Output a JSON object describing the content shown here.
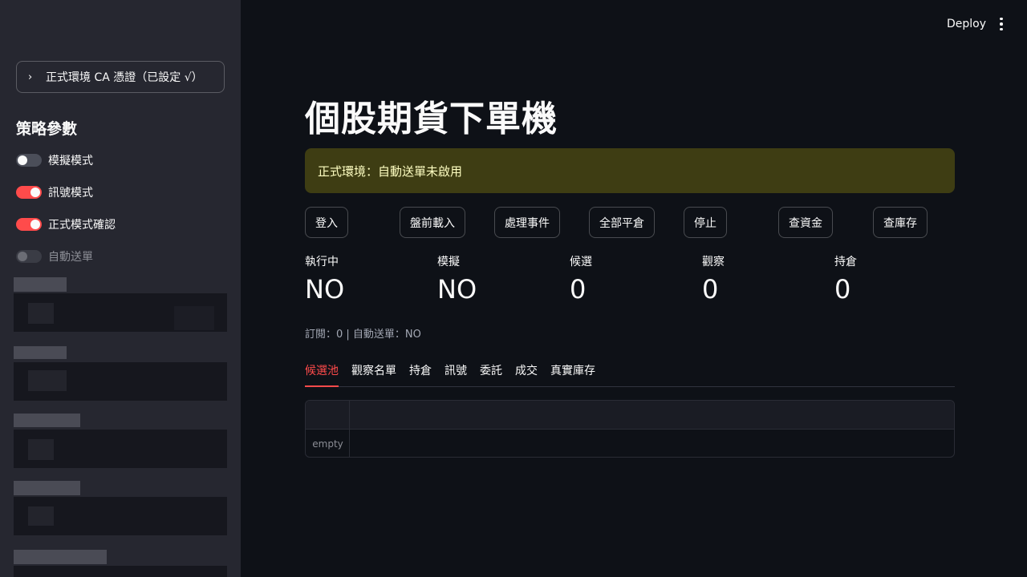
{
  "sidebar": {
    "expander_label": "正式環境 CA 憑證（已設定 √）",
    "heading": "策略參數",
    "toggles": [
      {
        "label": "模擬模式",
        "state": "off"
      },
      {
        "label": "訊號模式",
        "state": "on"
      },
      {
        "label": "正式模式確認",
        "state": "on"
      },
      {
        "label": "自動送單",
        "state": "disabled"
      }
    ]
  },
  "header": {
    "deploy_label": "Deploy",
    "menu_icon": "more-vertical-icon"
  },
  "main": {
    "title": "個股期貨下單機",
    "warning": "正式環境：自動送單未啟用",
    "buttons": [
      "登入",
      "盤前載入",
      "處理事件",
      "全部平倉",
      "停止",
      "查資金",
      "查庫存"
    ],
    "metrics": [
      {
        "label": "執行中",
        "value": "NO"
      },
      {
        "label": "模擬",
        "value": "NO"
      },
      {
        "label": "候選",
        "value": "0"
      },
      {
        "label": "觀察",
        "value": "0"
      },
      {
        "label": "持倉",
        "value": "0"
      }
    ],
    "caption": "訂閱：0 | 自動送單：NO",
    "tabs": [
      "候選池",
      "觀察名單",
      "持倉",
      "訊號",
      "委託",
      "成交",
      "真實庫存"
    ],
    "active_tab": "候選池",
    "table_empty_label": "empty"
  },
  "colors": {
    "accent": "#ff4b4b",
    "background": "#0e1117",
    "sidebar": "#262730",
    "warning_bg": "#3e3d13",
    "warning_text": "#ffffc2"
  }
}
